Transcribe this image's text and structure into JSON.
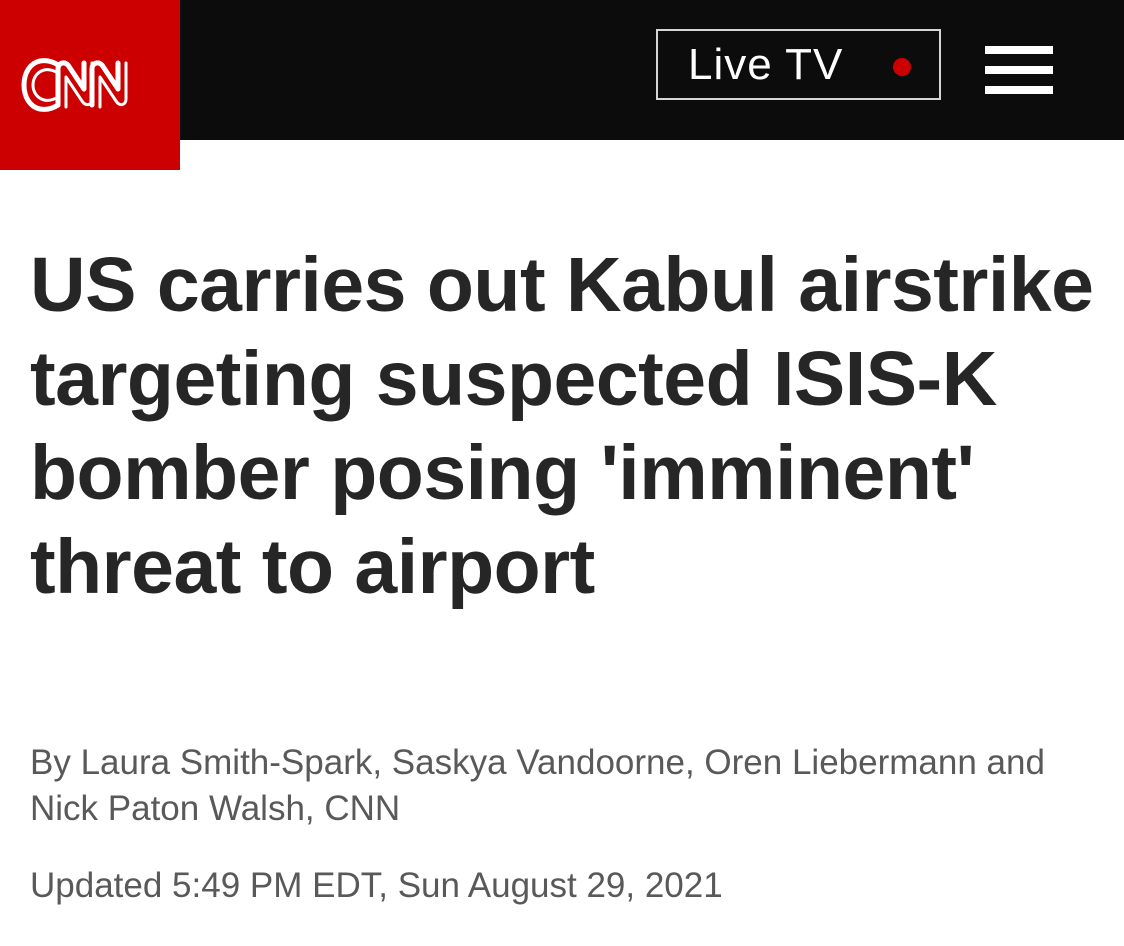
{
  "header": {
    "logo_text": "CNN",
    "live_tv_label": "Live TV",
    "live_indicator_color": "#cc0000",
    "menu_icon": "hamburger-menu-icon",
    "brand_color": "#cc0000",
    "bar_color": "#0c0c0c"
  },
  "article": {
    "headline": "US carries out Kabul airstrike targeting suspected ISIS-K bomber posing 'imminent' threat to airport",
    "byline": "By Laura Smith-Spark, Saskya Vandoorne, Oren Liebermann and Nick Paton Walsh, CNN",
    "updated": "Updated 5:49 PM EDT, Sun August 29, 2021"
  }
}
